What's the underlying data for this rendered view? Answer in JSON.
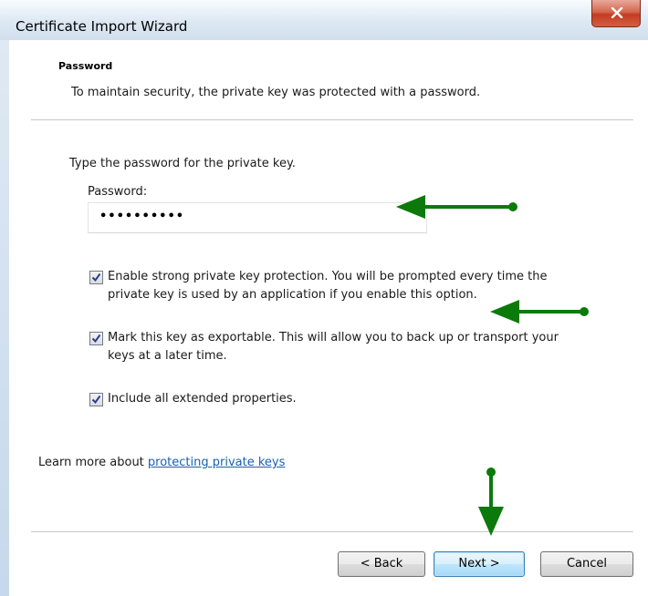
{
  "window": {
    "title": "Certificate Import Wizard"
  },
  "header": {
    "heading": "Password",
    "subheading": "To maintain security, the private key was protected with a password."
  },
  "body": {
    "instruction": "Type the password for the private key.",
    "password_label": "Password:",
    "password_value": "••••••••••",
    "options": [
      {
        "line1": "Enable strong private key protection. You will be prompted every time the",
        "line2": "private key is used by an application if you enable this option.",
        "checked": true
      },
      {
        "line1": "Mark this key as exportable. This will allow you to back up or transport your",
        "line2": "keys at a later time.",
        "checked": true
      },
      {
        "line1": "Include all extended properties.",
        "checked": true
      }
    ],
    "learn_more_prefix": "Learn more about ",
    "learn_more_link": "protecting private keys"
  },
  "footer": {
    "back_label": "< Back",
    "next_label": "Next >",
    "cancel_label": "Cancel"
  },
  "colors": {
    "annotation_arrow": "#0b7a0b",
    "link": "#1a5fb4",
    "close_button": "#c43c23"
  }
}
